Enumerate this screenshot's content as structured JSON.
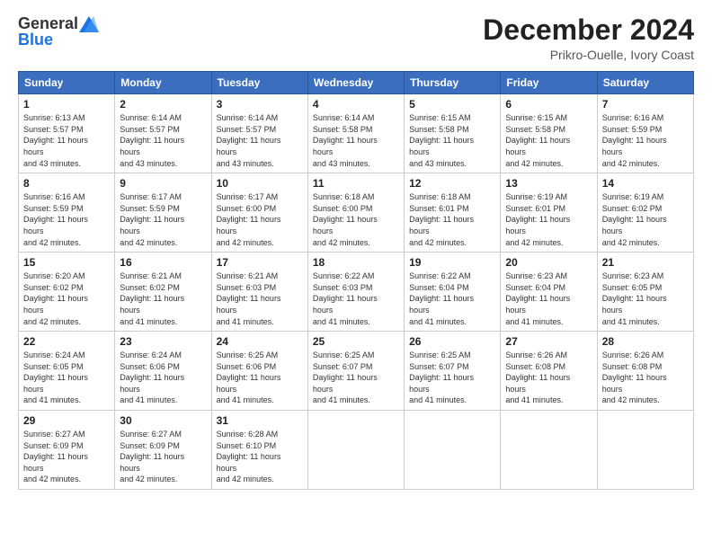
{
  "header": {
    "logo_line1": "General",
    "logo_line2": "Blue",
    "month_title": "December 2024",
    "location": "Prikro-Ouelle, Ivory Coast"
  },
  "days_of_week": [
    "Sunday",
    "Monday",
    "Tuesday",
    "Wednesday",
    "Thursday",
    "Friday",
    "Saturday"
  ],
  "weeks": [
    [
      {
        "day": "1",
        "sunrise": "6:13 AM",
        "sunset": "5:57 PM",
        "daylight": "11 hours and 43 minutes."
      },
      {
        "day": "2",
        "sunrise": "6:14 AM",
        "sunset": "5:57 PM",
        "daylight": "11 hours and 43 minutes."
      },
      {
        "day": "3",
        "sunrise": "6:14 AM",
        "sunset": "5:57 PM",
        "daylight": "11 hours and 43 minutes."
      },
      {
        "day": "4",
        "sunrise": "6:14 AM",
        "sunset": "5:58 PM",
        "daylight": "11 hours and 43 minutes."
      },
      {
        "day": "5",
        "sunrise": "6:15 AM",
        "sunset": "5:58 PM",
        "daylight": "11 hours and 43 minutes."
      },
      {
        "day": "6",
        "sunrise": "6:15 AM",
        "sunset": "5:58 PM",
        "daylight": "11 hours and 42 minutes."
      },
      {
        "day": "7",
        "sunrise": "6:16 AM",
        "sunset": "5:59 PM",
        "daylight": "11 hours and 42 minutes."
      }
    ],
    [
      {
        "day": "8",
        "sunrise": "6:16 AM",
        "sunset": "5:59 PM",
        "daylight": "11 hours and 42 minutes."
      },
      {
        "day": "9",
        "sunrise": "6:17 AM",
        "sunset": "5:59 PM",
        "daylight": "11 hours and 42 minutes."
      },
      {
        "day": "10",
        "sunrise": "6:17 AM",
        "sunset": "6:00 PM",
        "daylight": "11 hours and 42 minutes."
      },
      {
        "day": "11",
        "sunrise": "6:18 AM",
        "sunset": "6:00 PM",
        "daylight": "11 hours and 42 minutes."
      },
      {
        "day": "12",
        "sunrise": "6:18 AM",
        "sunset": "6:01 PM",
        "daylight": "11 hours and 42 minutes."
      },
      {
        "day": "13",
        "sunrise": "6:19 AM",
        "sunset": "6:01 PM",
        "daylight": "11 hours and 42 minutes."
      },
      {
        "day": "14",
        "sunrise": "6:19 AM",
        "sunset": "6:02 PM",
        "daylight": "11 hours and 42 minutes."
      }
    ],
    [
      {
        "day": "15",
        "sunrise": "6:20 AM",
        "sunset": "6:02 PM",
        "daylight": "11 hours and 42 minutes."
      },
      {
        "day": "16",
        "sunrise": "6:21 AM",
        "sunset": "6:02 PM",
        "daylight": "11 hours and 41 minutes."
      },
      {
        "day": "17",
        "sunrise": "6:21 AM",
        "sunset": "6:03 PM",
        "daylight": "11 hours and 41 minutes."
      },
      {
        "day": "18",
        "sunrise": "6:22 AM",
        "sunset": "6:03 PM",
        "daylight": "11 hours and 41 minutes."
      },
      {
        "day": "19",
        "sunrise": "6:22 AM",
        "sunset": "6:04 PM",
        "daylight": "11 hours and 41 minutes."
      },
      {
        "day": "20",
        "sunrise": "6:23 AM",
        "sunset": "6:04 PM",
        "daylight": "11 hours and 41 minutes."
      },
      {
        "day": "21",
        "sunrise": "6:23 AM",
        "sunset": "6:05 PM",
        "daylight": "11 hours and 41 minutes."
      }
    ],
    [
      {
        "day": "22",
        "sunrise": "6:24 AM",
        "sunset": "6:05 PM",
        "daylight": "11 hours and 41 minutes."
      },
      {
        "day": "23",
        "sunrise": "6:24 AM",
        "sunset": "6:06 PM",
        "daylight": "11 hours and 41 minutes."
      },
      {
        "day": "24",
        "sunrise": "6:25 AM",
        "sunset": "6:06 PM",
        "daylight": "11 hours and 41 minutes."
      },
      {
        "day": "25",
        "sunrise": "6:25 AM",
        "sunset": "6:07 PM",
        "daylight": "11 hours and 41 minutes."
      },
      {
        "day": "26",
        "sunrise": "6:25 AM",
        "sunset": "6:07 PM",
        "daylight": "11 hours and 41 minutes."
      },
      {
        "day": "27",
        "sunrise": "6:26 AM",
        "sunset": "6:08 PM",
        "daylight": "11 hours and 41 minutes."
      },
      {
        "day": "28",
        "sunrise": "6:26 AM",
        "sunset": "6:08 PM",
        "daylight": "11 hours and 42 minutes."
      }
    ],
    [
      {
        "day": "29",
        "sunrise": "6:27 AM",
        "sunset": "6:09 PM",
        "daylight": "11 hours and 42 minutes."
      },
      {
        "day": "30",
        "sunrise": "6:27 AM",
        "sunset": "6:09 PM",
        "daylight": "11 hours and 42 minutes."
      },
      {
        "day": "31",
        "sunrise": "6:28 AM",
        "sunset": "6:10 PM",
        "daylight": "11 hours and 42 minutes."
      },
      null,
      null,
      null,
      null
    ]
  ]
}
